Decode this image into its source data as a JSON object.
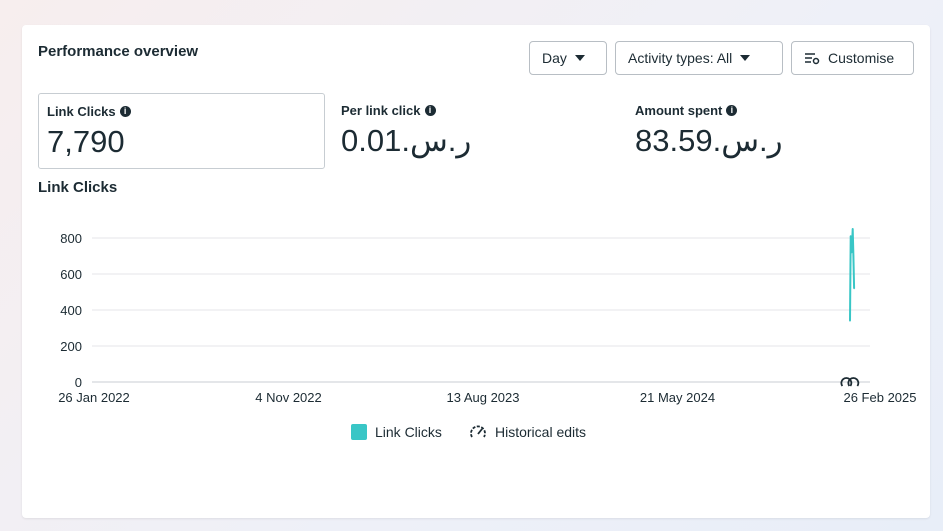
{
  "header": {
    "title": "Performance overview"
  },
  "toolbar": {
    "day_label": "Day",
    "activity_label": "Activity types: All",
    "customise_label": "Customise"
  },
  "metrics": [
    {
      "label": "Link Clicks",
      "value": "7,790"
    },
    {
      "label": "Per link click",
      "value": "0.01.ر.س"
    },
    {
      "label": "Amount spent",
      "value": "83.59.ر.س"
    }
  ],
  "chart_data": {
    "type": "line",
    "title": "Link Clicks",
    "xlabel": "",
    "ylabel": "",
    "ylim": [
      0,
      800
    ],
    "yticks": [
      "0",
      "200",
      "400",
      "600",
      "800"
    ],
    "xticks": [
      "26 Jan 2022",
      "4 Nov 2022",
      "13 Aug 2023",
      "21 May 2024",
      "26 Feb 2025"
    ],
    "series": [
      {
        "name": "Link Clicks",
        "color": "#39c6c6",
        "x": [
          "2025-01-28",
          "2025-01-29",
          "2025-01-30",
          "2025-01-31",
          "2025-02-01",
          "2025-02-02",
          "2025-02-03"
        ],
        "values": [
          340,
          810,
          720,
          770,
          850,
          700,
          520
        ]
      }
    ],
    "grid": true,
    "legend": [
      {
        "label": "Link Clicks",
        "icon": "teal-square"
      },
      {
        "label": "Historical edits",
        "icon": "gauge-icon"
      }
    ]
  }
}
